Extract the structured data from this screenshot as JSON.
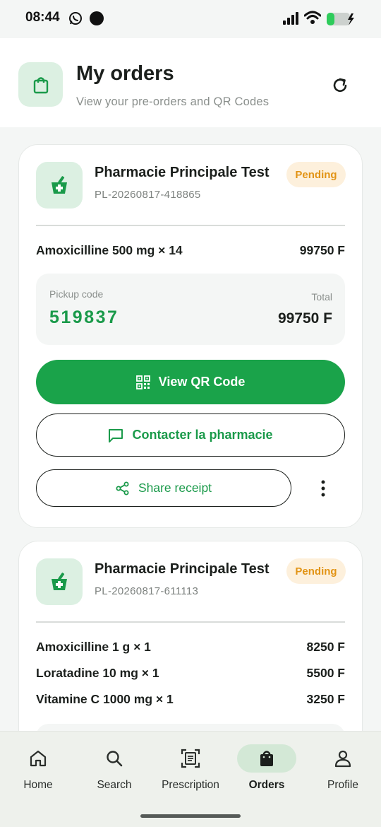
{
  "status_bar": {
    "time": "08:44",
    "icons": [
      "whatsapp-icon",
      "notification-dot-icon",
      "signal-icon",
      "wifi-icon",
      "battery-charging-icon"
    ]
  },
  "header": {
    "title": "My orders",
    "subtitle": "View your pre-orders and QR Codes",
    "badge_icon": "shopping-bag-icon",
    "refresh_icon": "refresh-icon"
  },
  "colors": {
    "accent": "#1aa34a",
    "accent_text": "#1a9a4a",
    "pending_bg": "#fdf0dc",
    "pending_text": "#e29416",
    "badge_bg": "#dcf0e2"
  },
  "orders": [
    {
      "pharmacy": "Pharmacie Principale Test",
      "reference": "PL-20260817-418865",
      "status": "Pending",
      "items": [
        {
          "name": "Amoxicilline 500 mg × 14",
          "price": "99750 F"
        }
      ],
      "pickup_label": "Pickup code",
      "pickup_code": "519837",
      "total_label": "Total",
      "total": "99750 F",
      "qr_button": "View QR Code",
      "contact_button": "Contacter la pharmacie",
      "share_button": "Share receipt"
    },
    {
      "pharmacy": "Pharmacie Principale Test",
      "reference": "PL-20260817-611113",
      "status": "Pending",
      "items": [
        {
          "name": "Amoxicilline 1 g × 1",
          "price": "8250 F"
        },
        {
          "name": "Loratadine 10 mg × 1",
          "price": "5500 F"
        },
        {
          "name": "Vitamine C 1000 mg × 1",
          "price": "3250 F"
        }
      ]
    }
  ],
  "bottom_nav": [
    {
      "label": "Home",
      "icon": "home-icon",
      "active": false
    },
    {
      "label": "Search",
      "icon": "search-icon",
      "active": false
    },
    {
      "label": "Prescription",
      "icon": "prescription-scan-icon",
      "active": false
    },
    {
      "label": "Orders",
      "icon": "shopping-bag-icon",
      "active": true
    },
    {
      "label": "Profile",
      "icon": "profile-icon",
      "active": false
    }
  ]
}
